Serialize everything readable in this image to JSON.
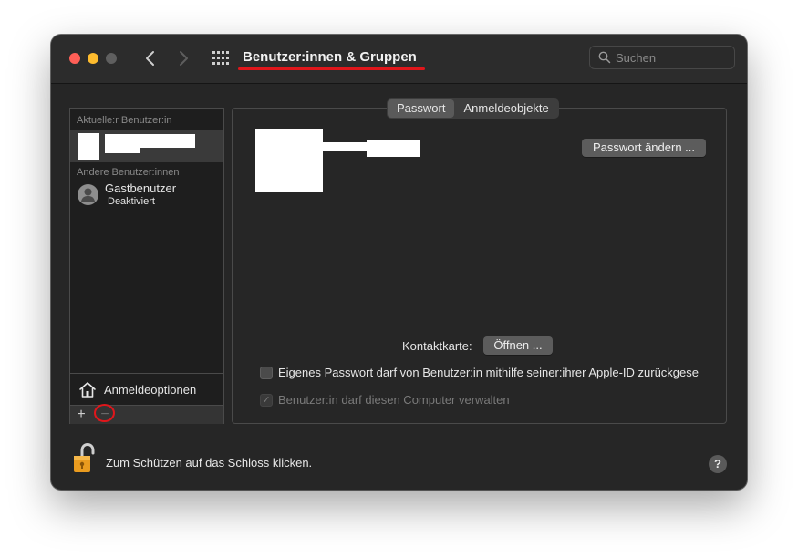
{
  "window": {
    "title": "Benutzer:innen & Gruppen",
    "search_placeholder": "Suchen"
  },
  "sidebar": {
    "current_section": "Aktuelle:r Benutzer:in",
    "other_section": "Andere Benutzer:innen",
    "guest": {
      "name": "Gastbenutzer",
      "status": "Deaktiviert"
    },
    "login_options": "Anmeldeoptionen",
    "add_label": "+",
    "remove_label": "−"
  },
  "tabs": [
    {
      "label": "Passwort",
      "active": true
    },
    {
      "label": "Anmeldeobjekte",
      "active": false
    }
  ],
  "main": {
    "change_password": "Passwort ändern ...",
    "contact_card_label": "Kontaktkarte:",
    "open_button": "Öffnen ...",
    "checkbox_reset": {
      "label": "Eigenes Passwort darf von Benutzer:in mithilfe seiner:ihrer Apple-ID zurückgese",
      "checked": false
    },
    "checkbox_admin": {
      "label": "Benutzer:in darf diesen Computer verwalten",
      "checked": true,
      "disabled": true
    }
  },
  "footer": {
    "lock_text": "Zum Schützen auf das Schloss klicken.",
    "help_label": "?"
  },
  "colors": {
    "annotation_red": "#e0161b",
    "close": "#ff5f57",
    "minimize": "#febc2e"
  }
}
